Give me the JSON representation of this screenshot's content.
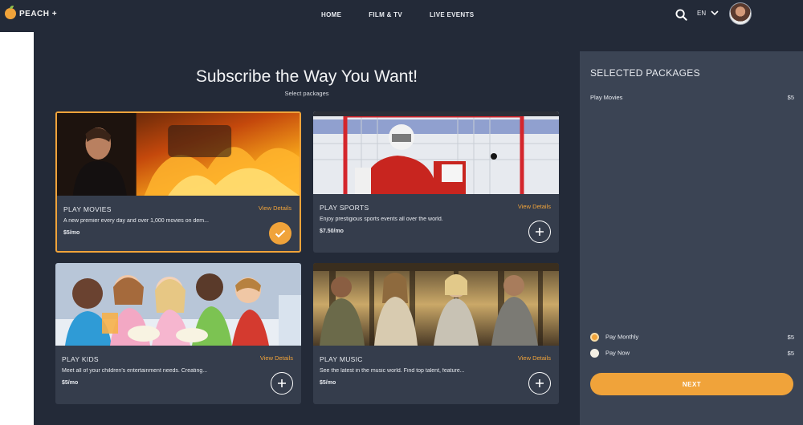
{
  "brand": {
    "name": "PEACH +"
  },
  "nav": {
    "items": [
      "HOME",
      "FILM & TV",
      "LIVE EVENTS"
    ]
  },
  "header": {
    "language": "EN"
  },
  "main": {
    "title": "Subscribe the Way You Want!",
    "subtitle": "Select packages",
    "packages": [
      {
        "name": "PLAY MOVIES",
        "details_label": "View Details",
        "description": "A new premier every day and over 1,000 movies on dem...",
        "price": "$5/mo",
        "selected": true
      },
      {
        "name": "PLAY SPORTS",
        "details_label": "View Details",
        "description": "Enjoy prestigious sports events all over the world.",
        "price": "$7.50/mo",
        "selected": false
      },
      {
        "name": "PLAY KIDS",
        "details_label": "View Details",
        "description": "Meet all of your children's entertainment needs. Creating...",
        "price": "$5/mo",
        "selected": false
      },
      {
        "name": "PLAY MUSIC",
        "details_label": "View Details",
        "description": "See the latest in the music world. Find top talent, feature...",
        "price": "$5/mo",
        "selected": false
      }
    ]
  },
  "sidebar": {
    "title": "SELECTED PACKAGES",
    "items": [
      {
        "name": "Play Movies",
        "price": "$5"
      }
    ],
    "payment_options": [
      {
        "label": "Pay Monthly",
        "price": "$5",
        "selected": true
      },
      {
        "label": "Pay Now",
        "price": "$5",
        "selected": false
      }
    ],
    "next_label": "NEXT"
  },
  "colors": {
    "accent": "#f0a33a",
    "background": "#232a38",
    "card": "#353d4c",
    "panel": "#3b4454"
  }
}
